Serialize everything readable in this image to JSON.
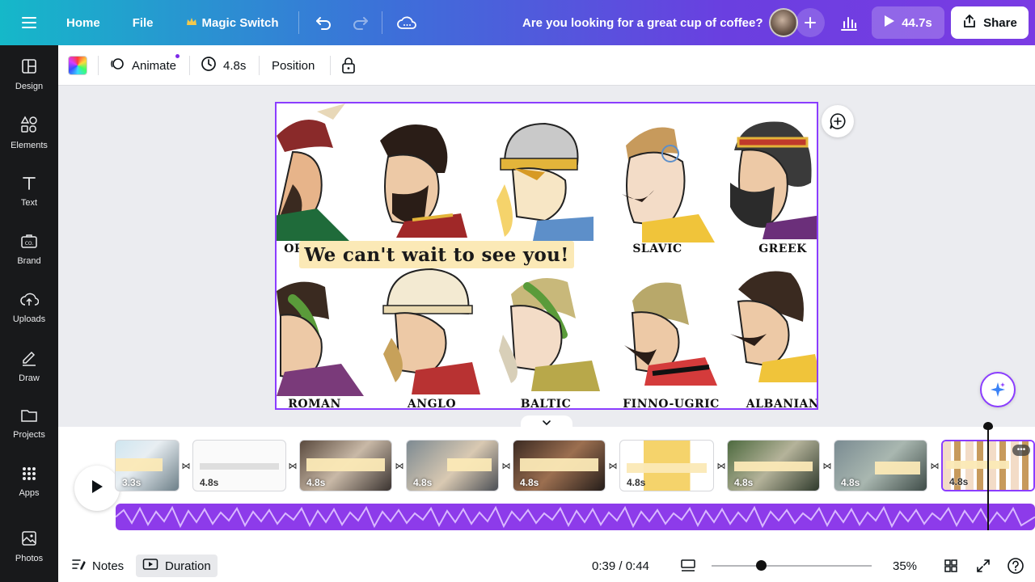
{
  "header": {
    "home_label": "Home",
    "file_label": "File",
    "magic_switch_label": "Magic Switch",
    "doc_title": "Are you looking for a great cup of coffee?",
    "play_duration": "44.7s",
    "share_label": "Share"
  },
  "sidebar": {
    "items": [
      {
        "label": "Design"
      },
      {
        "label": "Elements"
      },
      {
        "label": "Text"
      },
      {
        "label": "Brand"
      },
      {
        "label": "Uploads"
      },
      {
        "label": "Draw"
      },
      {
        "label": "Projects"
      },
      {
        "label": "Apps"
      },
      {
        "label": "Photos"
      }
    ]
  },
  "toolbar": {
    "animate_label": "Animate",
    "duration_label": "4.8s",
    "position_label": "Position"
  },
  "design": {
    "banner_text": "We can't wait to see you!",
    "labels": [
      "ORT",
      "SLAVIC",
      "GREEK",
      "ROMAN",
      "ANGLO",
      "BALTIC",
      "FINNO-UGRIC",
      "ALBANIAN"
    ]
  },
  "timeline": {
    "clips": [
      {
        "duration": "3.3s"
      },
      {
        "duration": "4.8s"
      },
      {
        "duration": "4.8s"
      },
      {
        "duration": "4.8s"
      },
      {
        "duration": "4.8s"
      },
      {
        "duration": "4.8s"
      },
      {
        "duration": "4.8s"
      },
      {
        "duration": "4.8s"
      },
      {
        "duration": "4.8s"
      }
    ]
  },
  "bottom": {
    "notes_label": "Notes",
    "duration_label": "Duration",
    "time_readout": "0:39 / 0:44",
    "zoom": "35%"
  },
  "colors": {
    "accent": "#8b3dff",
    "header_gradient_start": "#15b8c9",
    "header_gradient_end": "#7a3be3",
    "sidebar_bg": "#18191b",
    "audio_track": "#8d3bea",
    "banner_bg": "#fbe9b6"
  }
}
